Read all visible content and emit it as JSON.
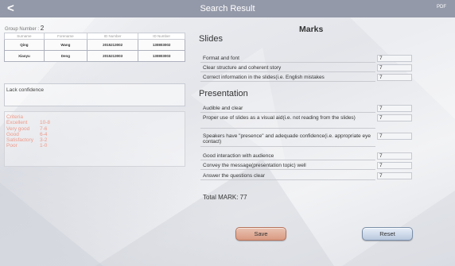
{
  "header": {
    "back_icon": "chevron-left-icon",
    "back_glyph": "<",
    "title": "Search Result",
    "pdf_label": "PDF",
    "bar_color": "#9499a9"
  },
  "group": {
    "label": "Group Number :",
    "number": "2"
  },
  "students_table": {
    "headers": [
      "Surname",
      "Forename",
      "ID Number",
      "ID Number"
    ],
    "rows": [
      [
        "Qing",
        "Wang",
        "2015213002",
        "130803002"
      ],
      [
        "Xiaoyu",
        "Deng",
        "2015213003",
        "130803003"
      ]
    ]
  },
  "comment": "Lack confidence",
  "criteria": {
    "title": "Criteria",
    "levels": [
      {
        "name": "Excellent",
        "range": "10-8"
      },
      {
        "name": "Very good",
        "range": "7-6"
      },
      {
        "name": "Good",
        "range": "6-4"
      },
      {
        "name": "Satisfactory",
        "range": "3-2"
      },
      {
        "name": "Poor",
        "range": "1-0"
      }
    ],
    "color": "#ee9a8a"
  },
  "marks": {
    "heading": "Marks",
    "slides": {
      "title": "Slides",
      "items": [
        {
          "label": "Format and font",
          "score": "7"
        },
        {
          "label": "Clear structure and coherent story",
          "score": "7"
        },
        {
          "label": "Correct information in the slides(i.e. English mistakes",
          "score": "7"
        }
      ]
    },
    "presentation": {
      "title": "Presentation",
      "items": [
        {
          "label": "Audible and clear",
          "score": "7"
        },
        {
          "label": "Proper use  of slides as a visual aid(i.e. not reading from the slides)",
          "score": "7"
        },
        {
          "label": "Speakers have \"presence\" and adequade confidence(i.e. appropriate eye contact)",
          "score": "7"
        },
        {
          "label": "Good interaction with audience",
          "score": "7"
        },
        {
          "label": "Convey the message(presentation topic) well",
          "score": "7"
        },
        {
          "label": "Answer the questions clear",
          "score": "7"
        }
      ]
    }
  },
  "total": "Total MARK:  77",
  "buttons": {
    "save": "Save",
    "reset": "Reset"
  }
}
